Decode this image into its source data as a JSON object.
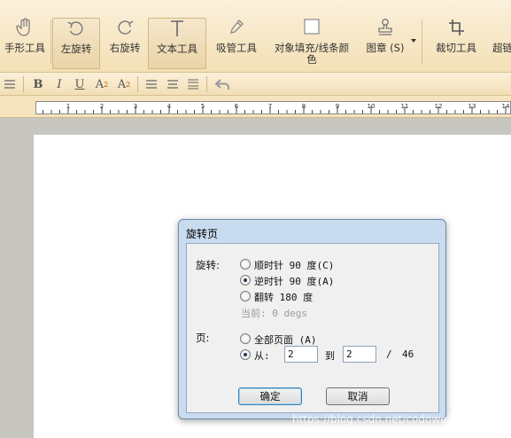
{
  "toolbar": {
    "tools": [
      {
        "label": "手形工具",
        "icon": "hand-icon"
      },
      {
        "label": "左旋转",
        "icon": "rotate-left-icon",
        "active": true
      },
      {
        "label": "右旋转",
        "icon": "rotate-right-icon"
      },
      {
        "label": "文本工具",
        "icon": "text-tool-icon",
        "active": true
      },
      {
        "label": "吸管工具",
        "icon": "eyedropper-icon"
      },
      {
        "label": "对象填充/线条颜",
        "label2": "色",
        "icon": "fill-color-icon"
      },
      {
        "label": "图章 (S)",
        "icon": "stamp-icon"
      },
      {
        "label": "裁切工具",
        "icon": "crop-icon"
      },
      {
        "label": "超链",
        "icon": "link-icon"
      }
    ]
  },
  "format_toolbar": {
    "bold": "B",
    "italic": "I",
    "underline": "U",
    "superscript": "A",
    "superscript_mark": "2",
    "subscript": "A",
    "subscript_mark": "2"
  },
  "ruler": {
    "labels": [
      "1",
      "2",
      "3",
      "4",
      "5",
      "6",
      "7",
      "8",
      "9",
      "10",
      "11",
      "12",
      "13",
      "14"
    ]
  },
  "dialog": {
    "title": "旋转页",
    "rotation": {
      "label": "旋转:",
      "options": [
        {
          "label": "顺时针 90 度(C)",
          "selected": false
        },
        {
          "label": "逆时针 90 度(A)",
          "selected": true
        },
        {
          "label": "翻转 180 度",
          "selected": false
        }
      ],
      "current": "当前:  0 degs"
    },
    "pages": {
      "label": "页:",
      "all_label": "全部页面 (A)",
      "from_label": "从:",
      "from_value": "2",
      "to_label": "到",
      "to_value": "2",
      "total_sep": "/",
      "total": "46"
    },
    "ok_label": "确定",
    "cancel_label": "取消"
  },
  "watermark": "https://blog.csdn.net/codowei0306",
  "colors": {
    "toolbar_bg": "#f3e0b6",
    "dialog_frame": "#c9dcef",
    "workspace": "#c7c6c1"
  }
}
